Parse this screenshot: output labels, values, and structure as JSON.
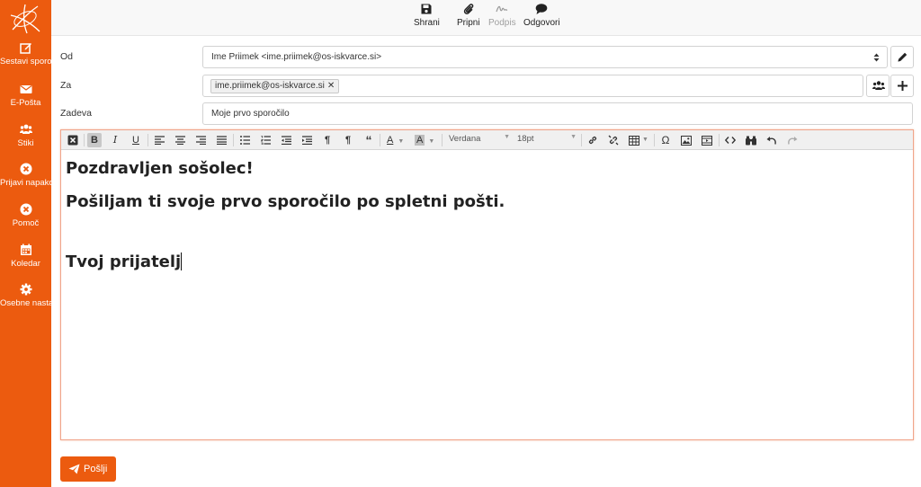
{
  "sidebar": {
    "items": [
      {
        "label": "Sestavi sporočilo",
        "icon": "edit-icon"
      },
      {
        "label": "E-Pošta",
        "icon": "envelope-icon"
      },
      {
        "label": "Stiki",
        "icon": "users-icon"
      },
      {
        "label": "Prijavi napako",
        "icon": "circle-x-icon"
      },
      {
        "label": "Pomoč",
        "icon": "circle-x-icon"
      },
      {
        "label": "Koledar",
        "icon": "calendar-icon"
      },
      {
        "label": "Osebne nastavitve",
        "icon": "gear-icon"
      }
    ]
  },
  "toolbar": {
    "save": "Shrani",
    "attach": "Pripni",
    "signature": "Podpis",
    "responses": "Odgovori"
  },
  "form": {
    "from_label": "Od",
    "from_value": "Ime Priimek <ime.priimek@os-iskvarce.si>",
    "to_label": "Za",
    "to_recipient": "ime.priimek@os-iskvarce.si",
    "subject_label": "Zadeva",
    "subject_value": "Moje prvo sporočilo"
  },
  "editor": {
    "font_family": "Verdana",
    "font_size": "18pt",
    "lines": [
      "Pozdravljen sošolec!",
      "Pošiljam ti svoje prvo sporočilo po spletni pošti.",
      "Tvoj prijatelj"
    ]
  },
  "send_label": "Pošlji",
  "colors": {
    "accent": "#ec5b0f"
  }
}
